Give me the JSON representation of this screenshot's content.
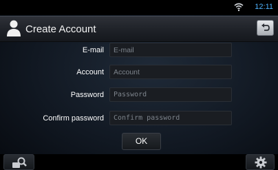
{
  "status_bar": {
    "time": "12:11",
    "wifi_icon": "wifi-icon",
    "time_color": "#4fb4ff"
  },
  "header": {
    "title": "Create Account",
    "user_icon": "user-icon",
    "back_icon": "back-arrow-icon"
  },
  "form": {
    "fields": [
      {
        "label": "E-mail",
        "value": "",
        "placeholder": "E-mail"
      },
      {
        "label": "Account",
        "value": "",
        "placeholder": "Account"
      },
      {
        "label": "Password",
        "value": "",
        "placeholder": "Password"
      },
      {
        "label": "Confirm password",
        "value": "",
        "placeholder": "Confirm password"
      }
    ],
    "ok_label": "OK"
  },
  "bottom_bar": {
    "search_icon": "search-icon",
    "settings_icon": "gear-icon"
  }
}
